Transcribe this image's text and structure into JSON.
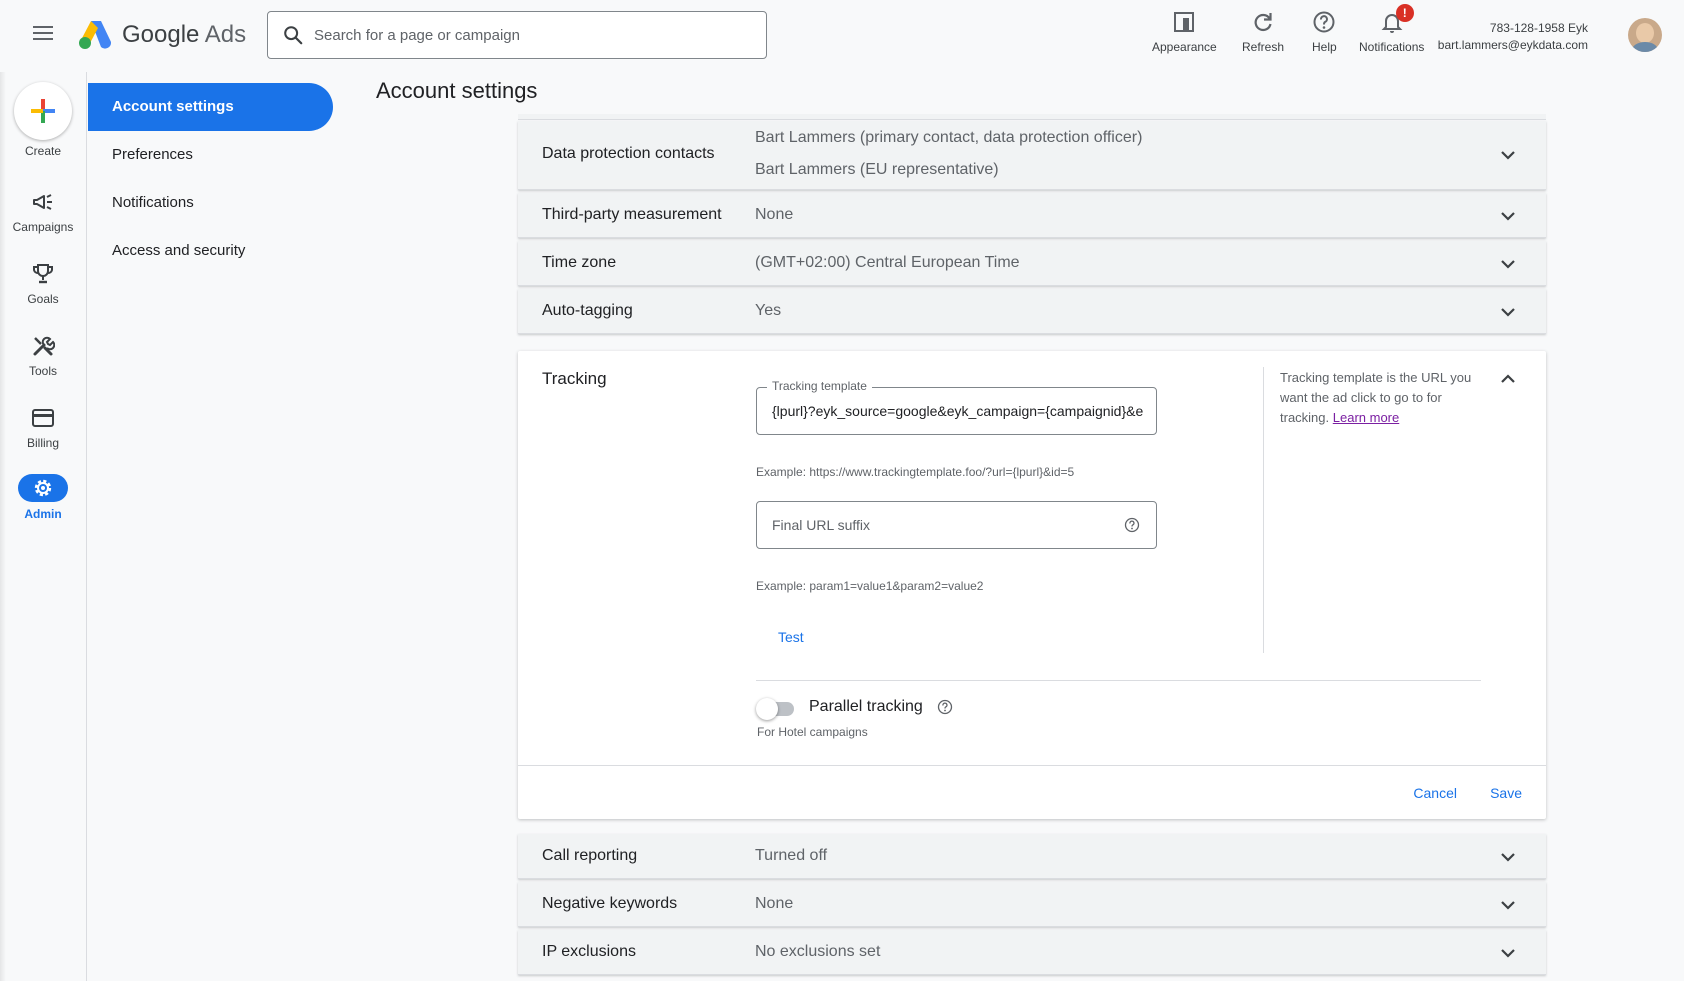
{
  "header": {
    "brand_google": "Google",
    "brand_ads": "Ads",
    "search_placeholder": "Search for a page or campaign",
    "tools": [
      {
        "label": "Appearance",
        "icon": "appearance-icon"
      },
      {
        "label": "Refresh",
        "icon": "refresh-icon"
      },
      {
        "label": "Help",
        "icon": "help-icon"
      },
      {
        "label": "Notifications",
        "icon": "bell-icon"
      }
    ],
    "notification_badge": "!",
    "account_id": "783-128-1958 Eyk",
    "account_email": "bart.lammers@eykdata.com"
  },
  "rail": {
    "create_label": "Create",
    "items": [
      {
        "label": "Campaigns",
        "icon": "megaphone-icon"
      },
      {
        "label": "Goals",
        "icon": "trophy-icon"
      },
      {
        "label": "Tools",
        "icon": "tools-icon"
      },
      {
        "label": "Billing",
        "icon": "credit-card-icon"
      },
      {
        "label": "Admin",
        "icon": "gear-icon",
        "active": true
      }
    ]
  },
  "subnav": {
    "items": [
      {
        "label": "Account settings",
        "active": true
      },
      {
        "label": "Preferences"
      },
      {
        "label": "Notifications"
      },
      {
        "label": "Access and security"
      }
    ]
  },
  "page": {
    "title": "Account settings"
  },
  "settings": {
    "data_protection": {
      "label": "Data protection contacts",
      "value_1": "Bart Lammers (primary contact, data protection officer)",
      "value_2": "Bart Lammers (EU representative)"
    },
    "third_party": {
      "label": "Third-party measurement",
      "value": "None"
    },
    "time_zone": {
      "label": "Time zone",
      "value": "(GMT+02:00) Central European Time"
    },
    "auto_tagging": {
      "label": "Auto-tagging",
      "value": "Yes"
    },
    "call_reporting": {
      "label": "Call reporting",
      "value": "Turned off"
    },
    "negative_keywords": {
      "label": "Negative keywords",
      "value": "None"
    },
    "ip_exclusions": {
      "label": "IP exclusions",
      "value": "No exclusions set"
    }
  },
  "tracking": {
    "title": "Tracking",
    "template_legend": "Tracking template",
    "template_value": "{lpurl}?eyk_source=google&eyk_campaign={campaignid}&e",
    "template_example": "Example: https://www.trackingtemplate.foo/?url={lpurl}&id=5",
    "suffix_placeholder": "Final URL suffix",
    "suffix_example": "Example: param1=value1&param2=value2",
    "test_label": "Test",
    "help_text": "Tracking template is the URL you want the ad click to go to for tracking.",
    "learn_more": "Learn more",
    "parallel_label": "Parallel tracking",
    "parallel_sub": "For Hotel campaigns",
    "parallel_enabled": false,
    "cancel_label": "Cancel",
    "save_label": "Save"
  },
  "colors": {
    "accent": "#1a73e8",
    "badge": "#d93025",
    "link_visited": "#7b1fa2"
  }
}
